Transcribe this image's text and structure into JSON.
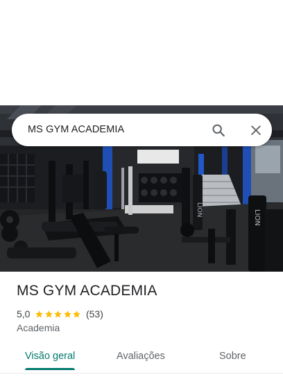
{
  "search": {
    "query": "MS GYM ACADEMIA",
    "search_icon": "search-icon",
    "close_icon": "close-icon"
  },
  "hero": {
    "image": "gym-interior-photo",
    "sign_text": "LION"
  },
  "place": {
    "name": "MS GYM ACADEMIA",
    "rating": "5,0",
    "stars": 5,
    "review_count": "(53)",
    "category": "Academia"
  },
  "tabs": [
    {
      "label": "Visão geral",
      "active": true
    },
    {
      "label": "Avaliações",
      "active": false
    },
    {
      "label": "Sobre",
      "active": false
    }
  ],
  "colors": {
    "accent": "#00796b",
    "star": "#fbbc04",
    "text_primary": "#202124",
    "text_secondary": "#5f6368"
  }
}
